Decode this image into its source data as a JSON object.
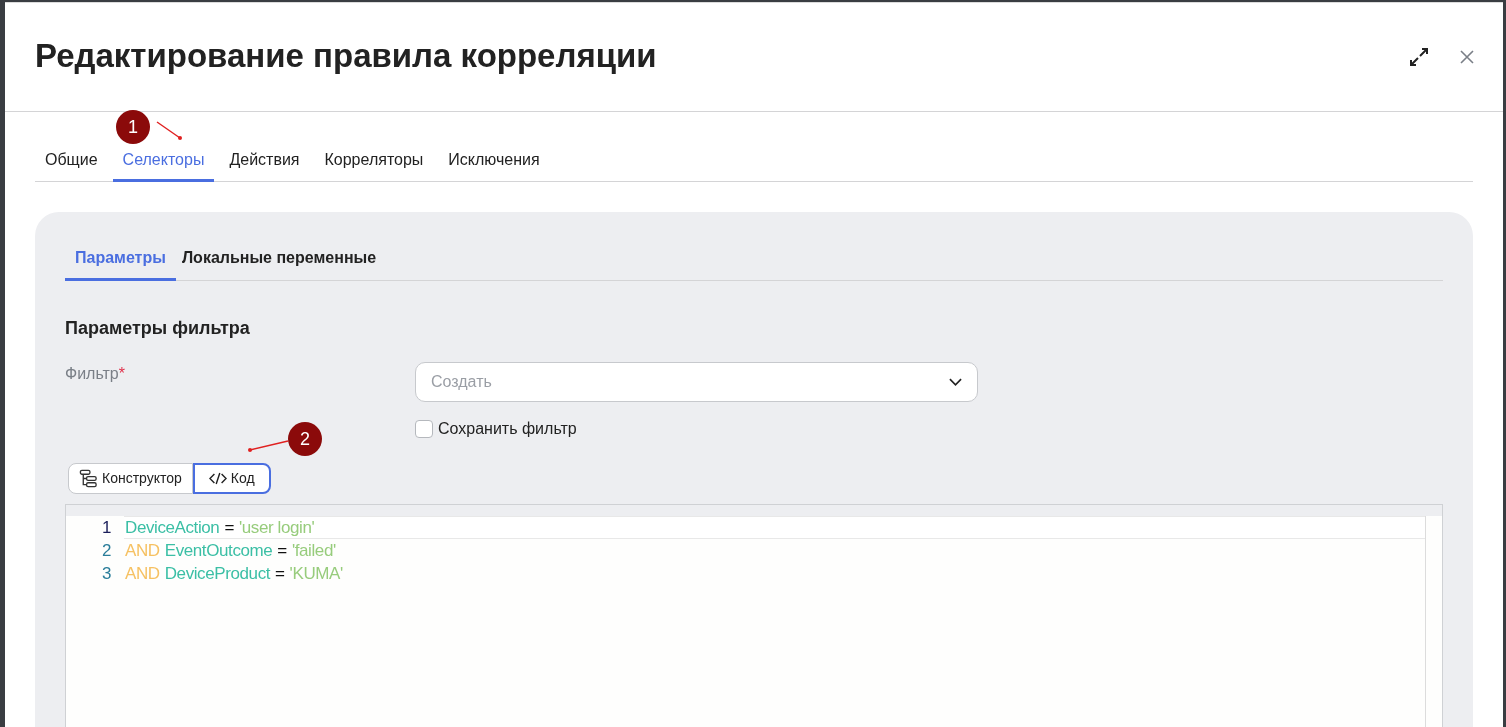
{
  "dialog": {
    "title": "Редактирование правила корреляции"
  },
  "tabs": [
    {
      "label": "Общие",
      "selected": false
    },
    {
      "label": "Селекторы",
      "selected": true
    },
    {
      "label": "Действия",
      "selected": false
    },
    {
      "label": "Корреляторы",
      "selected": false
    },
    {
      "label": "Исключения",
      "selected": false
    }
  ],
  "subtabs": [
    {
      "label": "Параметры",
      "selected": true
    },
    {
      "label": "Локальные переменные",
      "selected": false
    }
  ],
  "section_title": "Параметры фильтра",
  "filter": {
    "label": "Фильтр",
    "required_mark": "*",
    "placeholder": "Создать"
  },
  "save_filter": {
    "label": "Сохранить фильтр",
    "checked": false
  },
  "mode_buttons": [
    {
      "kind": "constructor",
      "label": "Конструктор",
      "selected": false
    },
    {
      "kind": "code",
      "label": "Код",
      "selected": true
    }
  ],
  "code_lines": [
    {
      "number": "1",
      "active": true,
      "tokens": [
        {
          "kind": "field",
          "text": "DeviceAction"
        },
        {
          "kind": "operator",
          "text": "="
        },
        {
          "kind": "string",
          "text": "'user login'"
        }
      ]
    },
    {
      "number": "2",
      "active": false,
      "tokens": [
        {
          "kind": "keyword",
          "text": "AND"
        },
        {
          "kind": "field",
          "text": "EventOutcome"
        },
        {
          "kind": "operator",
          "text": "="
        },
        {
          "kind": "string",
          "text": "'failed'"
        }
      ]
    },
    {
      "number": "3",
      "active": false,
      "tokens": [
        {
          "kind": "keyword",
          "text": "AND"
        },
        {
          "kind": "field",
          "text": "DeviceProduct"
        },
        {
          "kind": "operator",
          "text": "="
        },
        {
          "kind": "string",
          "text": "'KUMA'"
        }
      ]
    }
  ],
  "annotations": [
    {
      "label": "1"
    },
    {
      "label": "2"
    }
  ]
}
